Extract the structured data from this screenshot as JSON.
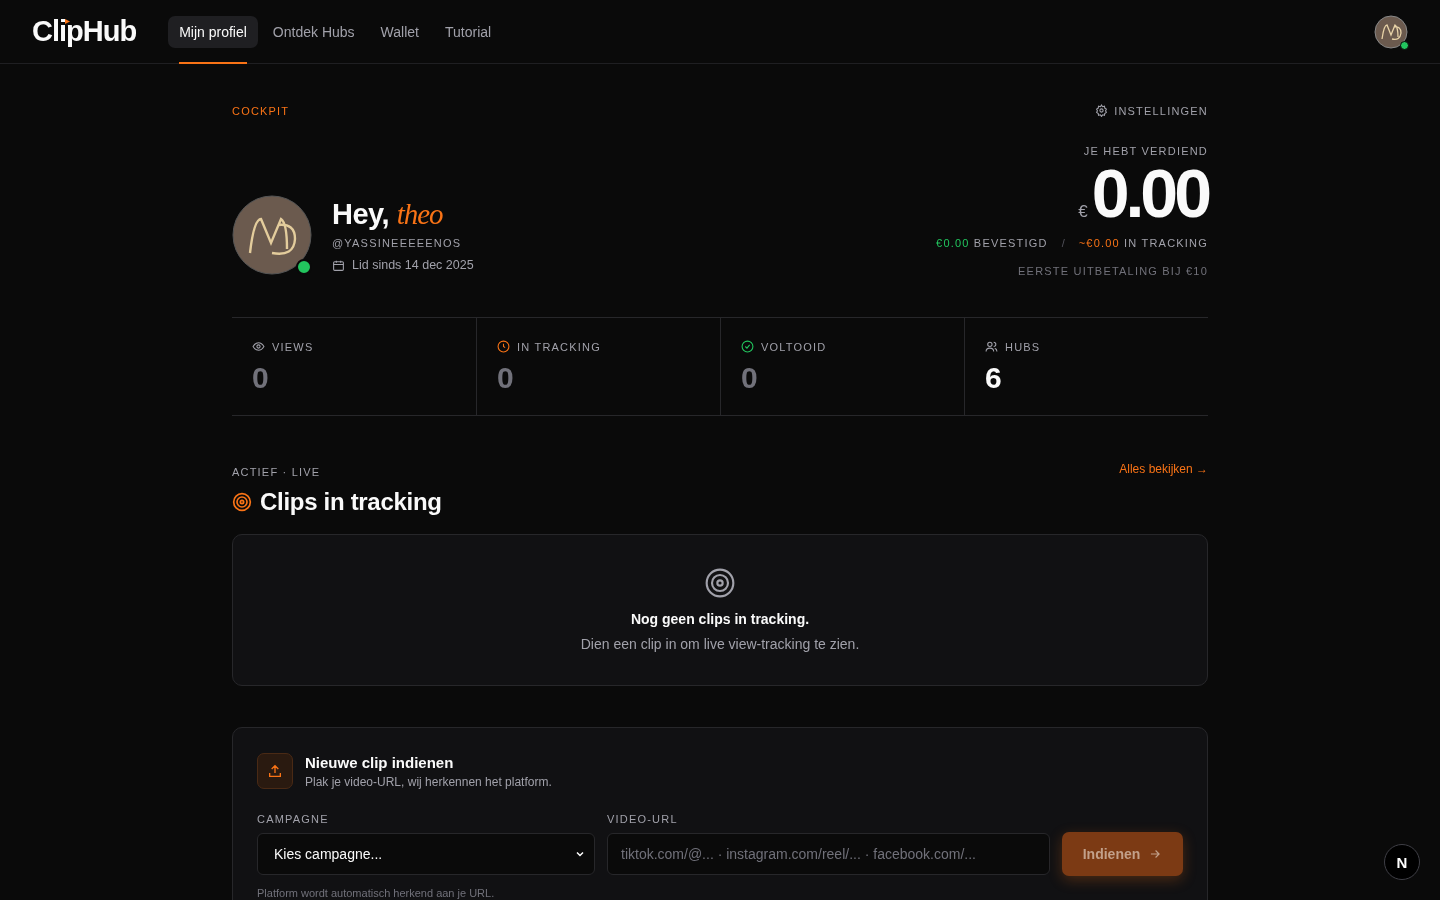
{
  "nav": {
    "logo": "ClipHub",
    "tabs": [
      {
        "label": "Mijn profiel",
        "selected": true
      },
      {
        "label": "Ontdek Hubs",
        "selected": false
      },
      {
        "label": "Wallet",
        "selected": false
      },
      {
        "label": "Tutorial",
        "selected": false
      }
    ],
    "avatar": {
      "online": true
    }
  },
  "cockpit": {
    "eyebrow": "COCKPIT",
    "settings": "INSTELLINGEN",
    "greeting": "Hey,",
    "name": "theo",
    "handle": "@YASSINEEEEENOS",
    "member_since": "Lid sinds 14 dec 2025",
    "online": true
  },
  "earnings": {
    "label": "JE HEBT VERDIEND",
    "currency": "€",
    "amount": "0.00",
    "confirmed_amount": "€0.00",
    "confirmed_label": "BEVESTIGD",
    "separator": "/",
    "tracking_amount": "~€0.00",
    "tracking_label": "IN TRACKING",
    "payout_note": "EERSTE UITBETALING BIJ €10"
  },
  "stats": [
    {
      "kind": "views",
      "label": "VIEWS",
      "value": "0",
      "muted": true
    },
    {
      "kind": "tracking",
      "label": "IN TRACKING",
      "value": "0",
      "muted": true
    },
    {
      "kind": "done",
      "label": "VOLTOOID",
      "value": "0",
      "muted": true
    },
    {
      "kind": "hubs",
      "label": "HUBS",
      "value": "6",
      "muted": false
    }
  ],
  "clips": {
    "eyebrow": "ACTIEF · LIVE",
    "title": "Clips in tracking",
    "link": "Alles bekijken →",
    "empty_title": "Nog geen clips in tracking.",
    "empty_text": "Dien een clip in om live view-tracking te zien."
  },
  "submit": {
    "title": "Nieuwe clip indienen",
    "subtitle": "Plak je video-URL, wij herkennen het platform.",
    "campaign_label": "CAMPAGNE",
    "campaign_value": "Kies campagne...",
    "url_label": "VIDEO-URL",
    "url_placeholder": "tiktok.com/@... · instagram.com/reel/... · facebook.com/...",
    "button": "Indienen",
    "hint": "Platform wordt automatisch herkend aan je URL."
  },
  "dev_badge": "N"
}
